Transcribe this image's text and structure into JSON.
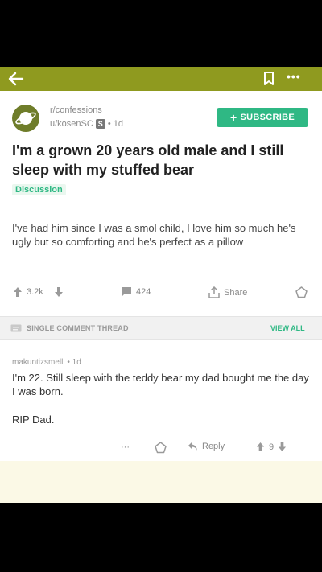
{
  "post": {
    "subreddit": "r/confessions",
    "author": "u/kosenSC",
    "badge": "S",
    "age": "• 1d",
    "subscribe_label": "SUBSCRIBE",
    "title": "I'm a grown 20 years old male and I still sleep with my stuffed bear",
    "flair": "Discussion",
    "body": "I've had him since I was a smol child, I love him so much he's ugly but so comforting and he's perfect as a pillow",
    "votes": "3.2k",
    "comments": "424",
    "share_label": "Share"
  },
  "thread": {
    "label": "SINGLE COMMENT THREAD",
    "view_all": "VIEW ALL"
  },
  "comment": {
    "meta": "makuntizsmelli • 1d",
    "line1": "I'm 22. Still sleep with the teddy bear my dad bought me the day I was born.",
    "line2": "RIP Dad.",
    "more": "···",
    "reply_label": "Reply",
    "votes": "9"
  },
  "colors": {
    "appbar": "#8f9a1f",
    "accent": "#2fb884",
    "strip": "#fbf9e6"
  },
  "icons": [
    "back-arrow-icon",
    "bookmark-icon",
    "more-icon",
    "upvote-icon",
    "downvote-icon",
    "comment-icon",
    "share-icon",
    "award-icon",
    "reply-icon",
    "thread-icon"
  ]
}
